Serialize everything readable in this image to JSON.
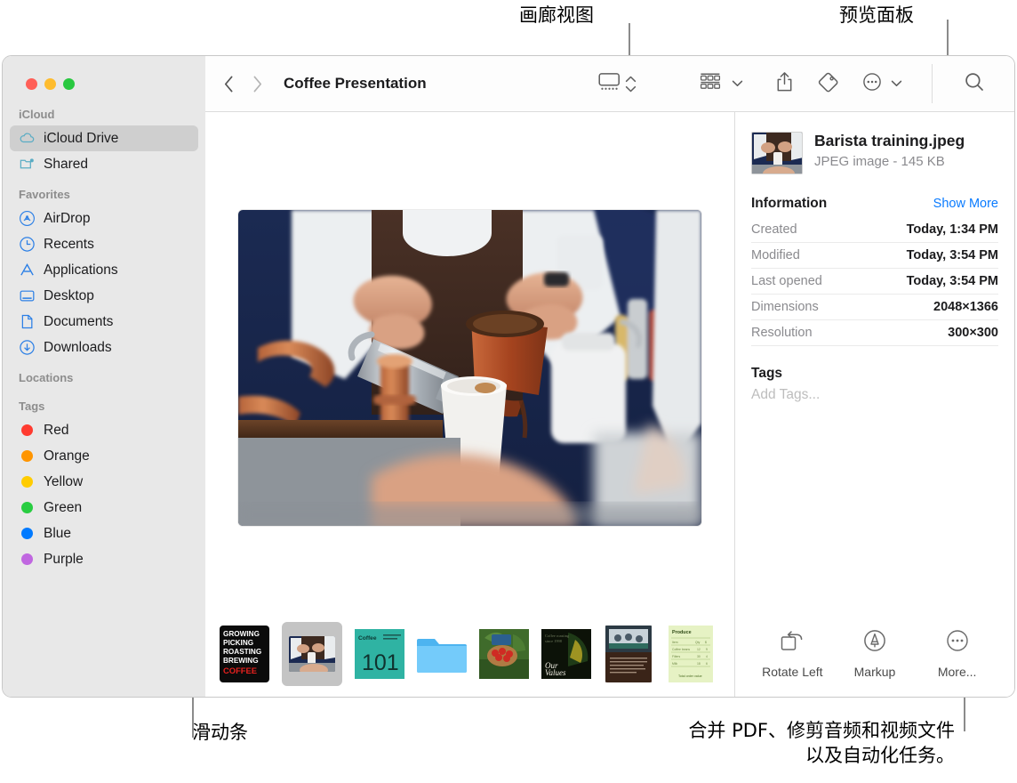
{
  "annotations": [
    {
      "id": "gallery-view",
      "text": "画廊视图"
    },
    {
      "id": "preview-panel",
      "text": "预览面板"
    },
    {
      "id": "scrubber",
      "text": "滑动条"
    },
    {
      "id": "more-line1",
      "text": "合并 PDF、修剪音频和视频文件"
    },
    {
      "id": "more-line2",
      "text": "以及自动化任务。"
    }
  ],
  "window": {
    "traffic_lights": [
      {
        "name": "close",
        "color": "#FF5F57"
      },
      {
        "name": "minimize",
        "color": "#FEBC2E"
      },
      {
        "name": "zoom",
        "color": "#28C840"
      }
    ]
  },
  "toolbar": {
    "back_icon": "chevron-left-icon",
    "forward_icon": "chevron-right-icon",
    "title": "Coffee Presentation",
    "view_icon": "gallery-view-icon",
    "view_stepper_icon": "chevron-up-down-icon",
    "group_icon": "group-by-icon",
    "group_chevron_icon": "chevron-down-icon",
    "share_icon": "share-icon",
    "tag_icon": "tag-icon",
    "more_icon": "ellipsis-circle-icon",
    "more_chevron_icon": "chevron-down-icon",
    "search_icon": "search-icon"
  },
  "sidebar": {
    "sections": [
      {
        "header": "iCloud",
        "items": [
          {
            "label": "iCloud Drive",
            "icon": "icloud-icon",
            "selected": true
          },
          {
            "label": "Shared",
            "icon": "shared-folder-icon",
            "selected": false
          }
        ]
      },
      {
        "header": "Favorites",
        "items": [
          {
            "label": "AirDrop",
            "icon": "airdrop-icon",
            "selected": false
          },
          {
            "label": "Recents",
            "icon": "clock-icon",
            "selected": false
          },
          {
            "label": "Applications",
            "icon": "applications-icon",
            "selected": false
          },
          {
            "label": "Desktop",
            "icon": "desktop-icon",
            "selected": false
          },
          {
            "label": "Documents",
            "icon": "document-icon",
            "selected": false
          },
          {
            "label": "Downloads",
            "icon": "downloads-icon",
            "selected": false
          }
        ]
      },
      {
        "header": "Locations",
        "items": []
      },
      {
        "header": "Tags",
        "items": [
          {
            "label": "Red",
            "icon": "tag-dot-icon",
            "color": "#FF3B30",
            "selected": false
          },
          {
            "label": "Orange",
            "icon": "tag-dot-icon",
            "color": "#FF9500",
            "selected": false
          },
          {
            "label": "Yellow",
            "icon": "tag-dot-icon",
            "color": "#FFCC00",
            "selected": false
          },
          {
            "label": "Green",
            "icon": "tag-dot-icon",
            "color": "#28CD41",
            "selected": false
          },
          {
            "label": "Blue",
            "icon": "tag-dot-icon",
            "color": "#007AFF",
            "selected": false
          },
          {
            "label": "Purple",
            "icon": "tag-dot-icon",
            "color": "#C067E0",
            "selected": false
          }
        ]
      }
    ]
  },
  "preview": {
    "hero_alt": "barista-pouring-coffee-photo",
    "thumbnails": [
      {
        "name": "growing-picking-roasting-brewing-coffee-poster",
        "selected": false
      },
      {
        "name": "barista-training-photo",
        "selected": true
      },
      {
        "name": "coffee-101-slide",
        "selected": false
      },
      {
        "name": "folder",
        "selected": false
      },
      {
        "name": "coffee-cherries-photo",
        "selected": false
      },
      {
        "name": "our-values-slide",
        "selected": false
      },
      {
        "name": "cafe-meeting-document",
        "selected": false
      },
      {
        "name": "produce-spreadsheet",
        "selected": false
      }
    ]
  },
  "info": {
    "file_name": "Barista training.jpeg",
    "file_meta": "JPEG image - 145 KB",
    "section_title": "Information",
    "show_more": "Show More",
    "rows": [
      {
        "key": "Created",
        "value": "Today, 1:34 PM"
      },
      {
        "key": "Modified",
        "value": "Today, 3:54 PM"
      },
      {
        "key": "Last opened",
        "value": "Today, 3:54 PM"
      },
      {
        "key": "Dimensions",
        "value": "2048×1366"
      },
      {
        "key": "Resolution",
        "value": "300×300"
      }
    ],
    "tags_title": "Tags",
    "tags_placeholder": "Add Tags...",
    "actions": [
      {
        "label": "Rotate Left",
        "icon": "rotate-left-icon"
      },
      {
        "label": "Markup",
        "icon": "markup-icon"
      },
      {
        "label": "More...",
        "icon": "ellipsis-circle-icon"
      }
    ]
  },
  "colors": {
    "accent": "#0a7bff",
    "sidebar_bg": "#e8e8e8",
    "selected_bg": "#cfcfcf"
  }
}
